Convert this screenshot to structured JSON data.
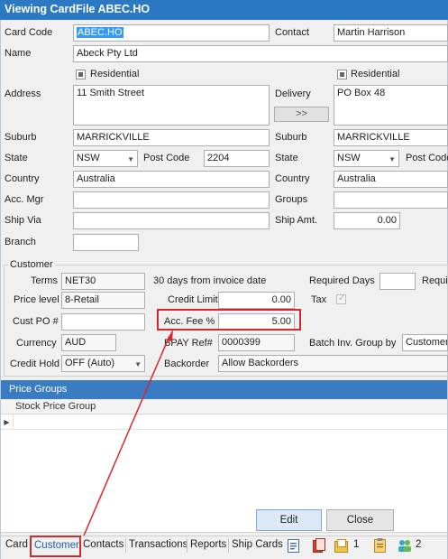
{
  "window": {
    "title": "Viewing CardFile ABEC.HO"
  },
  "card": {
    "card_code_label": "Card Code",
    "card_code": "ABEC.HO",
    "contact_label": "Contact",
    "contact": "Martin Harrison",
    "name_label": "Name",
    "name": "Abeck Pty Ltd",
    "residential_label": "Residential",
    "address_label": "Address",
    "address": "11 Smith Street",
    "delivery_label": "Delivery",
    "delivery": "PO Box 48",
    "copy_button": ">>",
    "suburb_label": "Suburb",
    "suburb": "MARRICKVILLE",
    "delivery_suburb": "MARRICKVILLE",
    "state_label": "State",
    "state": "NSW",
    "delivery_state": "NSW",
    "postcode_label": "Post Code",
    "postcode": "2204",
    "delivery_postcode_label": "Post Code",
    "country_label": "Country",
    "country": "Australia",
    "delivery_country": "Australia",
    "acc_mgr_label": "Acc. Mgr",
    "groups_label": "Groups",
    "ship_via_label": "Ship Via",
    "ship_amt_label": "Ship Amt.",
    "ship_amt": "0.00",
    "branch_label": "Branch"
  },
  "customer": {
    "group_title": "Customer",
    "terms_label": "Terms",
    "terms": "NET30",
    "terms_desc": "30 days from invoice date",
    "required_days_label": "Required Days",
    "required_label_cut": "Requi",
    "price_level_label": "Price level",
    "price_level": "8-Retail",
    "credit_limit_label": "Credit Limit",
    "credit_limit": "0.00",
    "tax_label": "Tax",
    "cust_po_label": "Cust PO #",
    "acc_fee_label": "Acc. Fee %",
    "acc_fee": "5.00",
    "currency_label": "Currency",
    "currency": "AUD",
    "bpay_label": "BPAY Ref#",
    "bpay": "0000399",
    "batch_label": "Batch Inv. Group by",
    "batch_value": "Customer",
    "credit_hold_label": "Credit Hold",
    "credit_hold": "OFF (Auto)",
    "backorder_label": "Backorder",
    "backorder": "Allow Backorders"
  },
  "price_groups": {
    "title": "Price Groups",
    "column": "Stock Price Group"
  },
  "buttons": {
    "edit": "Edit",
    "close": "Close"
  },
  "tabs": {
    "card": "Card",
    "customer": "Customer",
    "contacts": "Contacts",
    "transactions": "Transactions",
    "reports": "Reports",
    "ship_cards": "Ship Cards",
    "count_1": "1",
    "count_2": "2"
  },
  "colors": {
    "title_bar": "#2b79c2",
    "highlight_box": "#d9282b",
    "active_tab": "#1f5fa8"
  }
}
